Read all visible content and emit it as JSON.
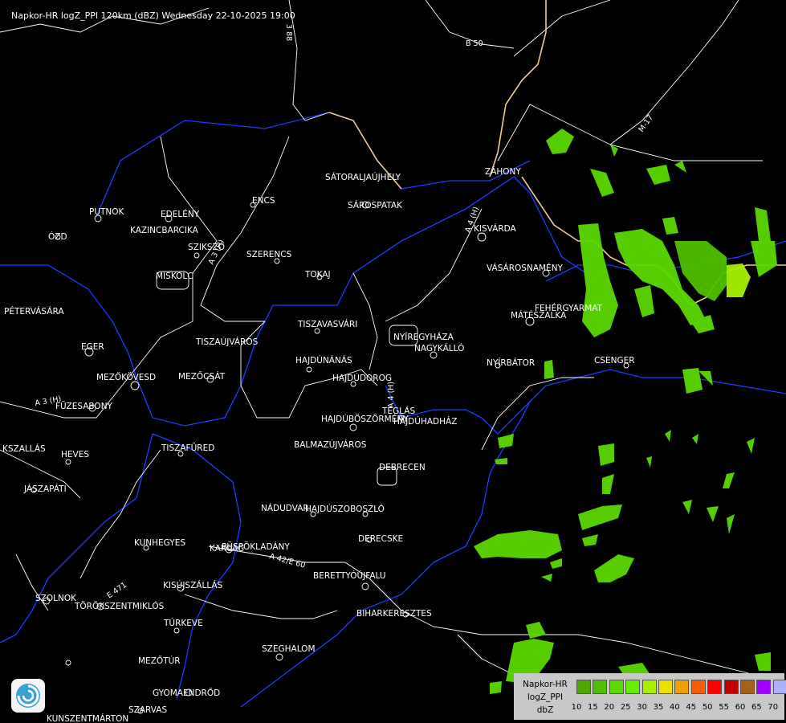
{
  "title": "Napkor-HR logZ_PPI 120km (dBZ) Wednesday 22-10-2025 19:00",
  "cities": [
    {
      "name": "SÁTORALJAÚJHELY"
    },
    {
      "name": "SÁROSPATAK"
    },
    {
      "name": "ZÁHONY"
    },
    {
      "name": "KISVÁRDA"
    },
    {
      "name": "VÁSÁROSNAMÉNY"
    },
    {
      "name": "FEHÉRGYARMAT"
    },
    {
      "name": "MÁTÉSZALKA"
    },
    {
      "name": "CSENGER"
    },
    {
      "name": "NYÍRBÁTOR"
    },
    {
      "name": "NAGYKÁLLÓ"
    },
    {
      "name": "NYÍREGYHÁZA"
    },
    {
      "name": "TISZAVASVÁRI"
    },
    {
      "name": "TOKAJ"
    },
    {
      "name": "SZERENCS"
    },
    {
      "name": "SZIKSZÓ"
    },
    {
      "name": "ENCS"
    },
    {
      "name": "EDELÉNY"
    },
    {
      "name": "PUTNOK"
    },
    {
      "name": "KAZINCBARCIKA"
    },
    {
      "name": "ÓZD"
    },
    {
      "name": "MISKOLC"
    },
    {
      "name": "PÉTERVÁSÁRA"
    },
    {
      "name": "EGER"
    },
    {
      "name": "TISZAÚJVÁROS"
    },
    {
      "name": "HAJDÚNÁNÁS"
    },
    {
      "name": "HAJDÚDOROG"
    },
    {
      "name": "MEZŐKÖVESD"
    },
    {
      "name": "MEZŐCSÁT"
    },
    {
      "name": "FÜZESABONY"
    },
    {
      "name": "TÉGLÁS"
    },
    {
      "name": "HAJDÚBÖSZÖRMÉNY"
    },
    {
      "name": "HAJDÚHADHÁZ"
    },
    {
      "name": "BALMAZÚJVÁROS"
    },
    {
      "name": "TISZAFÜRED"
    },
    {
      "name": "HEVES"
    },
    {
      "name": "KSZALLÁS"
    },
    {
      "name": "JÁSZAPÁTI"
    },
    {
      "name": "DEBRECEN"
    },
    {
      "name": "NÁDUDVAR"
    },
    {
      "name": "HAJDÚSZOBOSZLÓ"
    },
    {
      "name": "DERECSKE"
    },
    {
      "name": "KUNHEGYES"
    },
    {
      "name": "KARCAG"
    },
    {
      "name": "PÜSPÖKLADÁNY"
    },
    {
      "name": "BERETTYÓÚJFALU"
    },
    {
      "name": "KISÚJSZÁLLÁS"
    },
    {
      "name": "SZOLNOK"
    },
    {
      "name": "TÖRÖKSZENTMIKLÓS"
    },
    {
      "name": "TÚRKEVE"
    },
    {
      "name": "BIHARKERESZTES"
    },
    {
      "name": "SZEGHALOM"
    },
    {
      "name": "MEZŐTÚR"
    },
    {
      "name": "GYOMAENDRŐD"
    },
    {
      "name": "SZARVAS"
    },
    {
      "name": "KUNSZENTMÁRTON"
    }
  ],
  "roads": [
    "B 50",
    "M-17",
    "A 4 (H)",
    "A 3 (H)",
    "A 42/E 60",
    "E 471",
    "3 88"
  ],
  "legend": {
    "label_lines": [
      "Napkor-HR",
      "logZ_PPI",
      "dbZ"
    ],
    "unit": "dbZ",
    "bins": [
      {
        "dbz": "10",
        "color": "#4fa800"
      },
      {
        "dbz": "15",
        "color": "#52c000"
      },
      {
        "dbz": "20",
        "color": "#5ad800"
      },
      {
        "dbz": "25",
        "color": "#66ee00"
      },
      {
        "dbz": "30",
        "color": "#a8f000"
      },
      {
        "dbz": "35",
        "color": "#f0e000"
      },
      {
        "dbz": "40",
        "color": "#f0a000"
      },
      {
        "dbz": "45",
        "color": "#f06000"
      },
      {
        "dbz": "50",
        "color": "#ff0000"
      },
      {
        "dbz": "55",
        "color": "#c00000"
      },
      {
        "dbz": "60",
        "color": "#a86018"
      },
      {
        "dbz": "65",
        "color": "#a000ff"
      },
      {
        "dbz": "70",
        "color": "#b0b0ff"
      }
    ]
  },
  "colors": {
    "background": "#000000",
    "rivers": "#1e3cff",
    "borders": "#ffffff",
    "state_border": "#f0c896",
    "echo": "#5ad800"
  }
}
